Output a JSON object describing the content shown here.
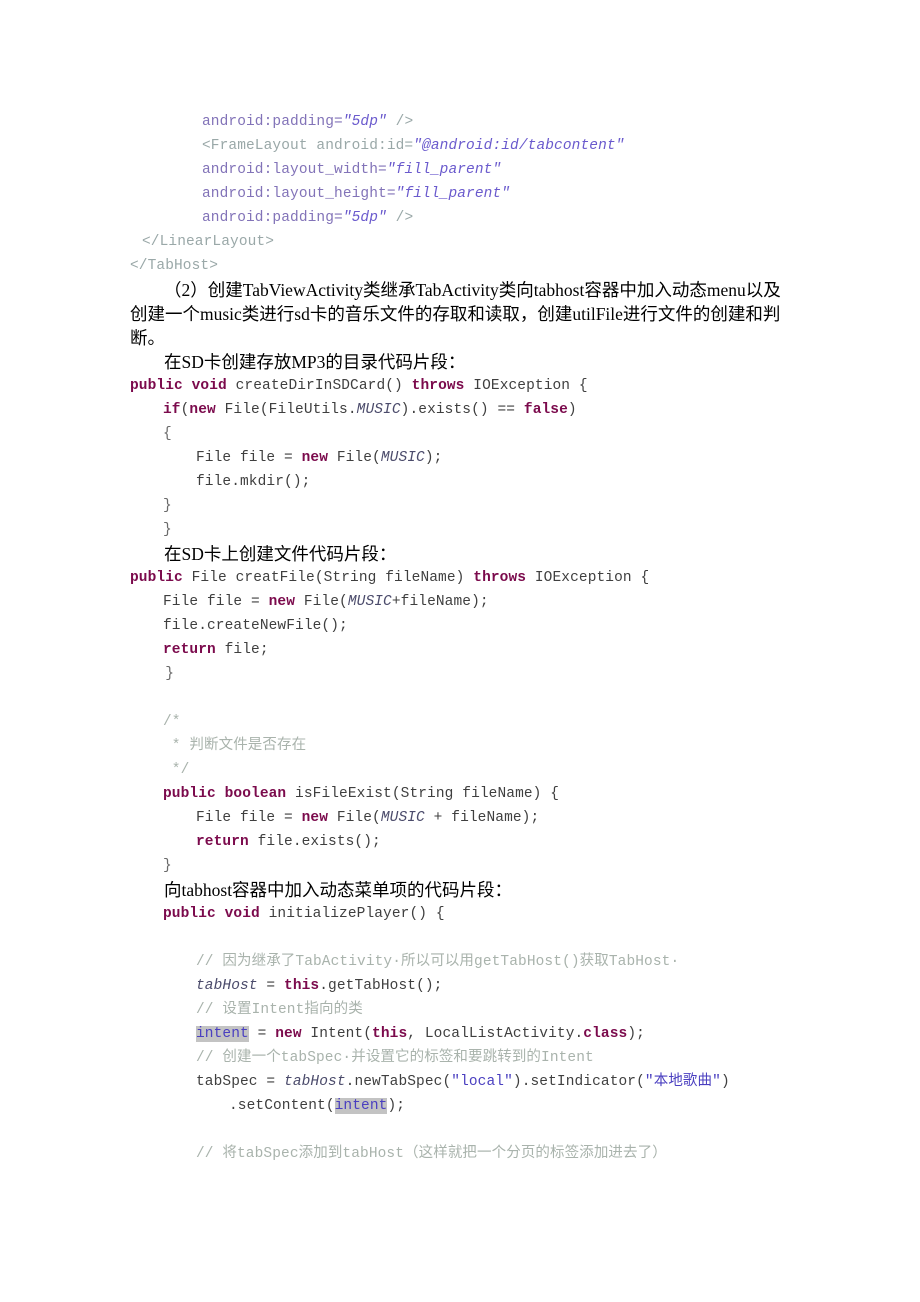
{
  "document": {
    "type": "technical-document-page",
    "language": "zh-CN",
    "page_background": "#ffffff"
  },
  "xml_block": {
    "lines": [
      {
        "indent": 2,
        "tokens": [
          {
            "t": "android:padding=",
            "c": "attr"
          },
          {
            "t": "\"5dp\"",
            "c": "str"
          },
          {
            "t": " />",
            "c": "punct"
          }
        ]
      },
      {
        "indent": 2,
        "tokens": [
          {
            "t": "<FrameLayout android:id=",
            "c": "name"
          },
          {
            "t": "\"@android:id/tabcontent\"",
            "c": "str"
          }
        ]
      },
      {
        "indent": 2,
        "tokens": [
          {
            "t": "android:layout_width=",
            "c": "attr"
          },
          {
            "t": "\"fill_parent\"",
            "c": "str"
          }
        ]
      },
      {
        "indent": 2,
        "tokens": [
          {
            "t": "android:layout_height=",
            "c": "attr"
          },
          {
            "t": "\"fill_parent\"",
            "c": "str"
          }
        ]
      },
      {
        "indent": 2,
        "tokens": [
          {
            "t": "android:padding=",
            "c": "attr"
          },
          {
            "t": "\"5dp\"",
            "c": "str"
          },
          {
            "t": " />",
            "c": "punct"
          }
        ]
      },
      {
        "indent": 1,
        "tokens": [
          {
            "t": "</LinearLayout>",
            "c": "tag"
          }
        ]
      },
      {
        "indent": 0,
        "tokens": [
          {
            "t": "</TabHost>",
            "c": "tag"
          }
        ]
      }
    ]
  },
  "paragraph_1": "（2）创建TabViewActivity类继承TabActivity类向tabhost容器中加入动态menu以及创建一个music类进行sd卡的音乐文件的存取和读取，创建utilFile进行文件的创建和判断。",
  "subhead_1": "在SD卡创建存放MP3的目录代码片段：",
  "code_block_1": {
    "lines": [
      {
        "indent": 0,
        "tokens": [
          {
            "t": "public void",
            "c": "kw"
          },
          {
            "t": " createDirInSDCard() ",
            "c": "plain"
          },
          {
            "t": "throws",
            "c": "kw"
          },
          {
            "t": " IOException {",
            "c": "plain"
          }
        ]
      },
      {
        "indent": 1,
        "tokens": [
          {
            "t": "if",
            "c": "kw"
          },
          {
            "t": "(",
            "c": "plain"
          },
          {
            "t": "new",
            "c": "kw"
          },
          {
            "t": " File(FileUtils.",
            "c": "plain"
          },
          {
            "t": "MUSIC",
            "c": "field"
          },
          {
            "t": ").exists() == ",
            "c": "plain"
          },
          {
            "t": "false",
            "c": "kw"
          },
          {
            "t": ")",
            "c": "plain"
          }
        ]
      },
      {
        "indent": 1,
        "tokens": [
          {
            "t": "{",
            "c": "brace"
          }
        ]
      },
      {
        "indent": 2,
        "tokens": [
          {
            "t": "File file = ",
            "c": "plain"
          },
          {
            "t": "new",
            "c": "kw"
          },
          {
            "t": " File(",
            "c": "plain"
          },
          {
            "t": "MUSIC",
            "c": "field"
          },
          {
            "t": ");",
            "c": "plain"
          }
        ]
      },
      {
        "indent": 2,
        "tokens": [
          {
            "t": "file.mkdir();",
            "c": "plain"
          }
        ]
      },
      {
        "indent": 1,
        "tokens": [
          {
            "t": "}",
            "c": "brace"
          }
        ]
      },
      {
        "indent": 1,
        "tokens": [
          {
            "t": "}",
            "c": "brace"
          }
        ]
      }
    ]
  },
  "subhead_2": "在SD卡上创建文件代码片段：",
  "code_block_2": {
    "lines": [
      {
        "indent": 0,
        "tokens": [
          {
            "t": "public",
            "c": "kw"
          },
          {
            "t": " File creatFile(String fileName) ",
            "c": "plain"
          },
          {
            "t": "throws",
            "c": "kw"
          },
          {
            "t": " IOException {",
            "c": "plain"
          }
        ]
      },
      {
        "indent": 1,
        "tokens": [
          {
            "t": "File file = ",
            "c": "plain"
          },
          {
            "t": "new",
            "c": "kw"
          },
          {
            "t": " File(",
            "c": "plain"
          },
          {
            "t": "MUSIC",
            "c": "field"
          },
          {
            "t": "+fileName);",
            "c": "plain"
          }
        ]
      },
      {
        "indent": 1,
        "tokens": [
          {
            "t": "file.createNewFile();",
            "c": "plain"
          }
        ]
      },
      {
        "indent": 1,
        "tokens": [
          {
            "t": "return",
            "c": "kw"
          },
          {
            "t": " file;",
            "c": "plain"
          }
        ]
      },
      {
        "indent": 0,
        "tokens": [
          {
            "t": "    }",
            "c": "brace"
          }
        ]
      },
      {
        "indent": 0,
        "tokens": [
          {
            "t": "",
            "c": "plain"
          }
        ]
      },
      {
        "indent": 1,
        "tokens": [
          {
            "t": "/*",
            "c": "cmt"
          }
        ]
      },
      {
        "indent": 1,
        "tokens": [
          {
            "t": " * 判断文件是否存在",
            "c": "cmt"
          }
        ]
      },
      {
        "indent": 1,
        "tokens": [
          {
            "t": " */",
            "c": "cmt"
          }
        ]
      },
      {
        "indent": 1,
        "tokens": [
          {
            "t": "public boolean",
            "c": "kw"
          },
          {
            "t": " isFileExist(String fileName) {",
            "c": "plain"
          }
        ]
      },
      {
        "indent": 2,
        "tokens": [
          {
            "t": "File file = ",
            "c": "plain"
          },
          {
            "t": "new",
            "c": "kw"
          },
          {
            "t": " File(",
            "c": "plain"
          },
          {
            "t": "MUSIC",
            "c": "field"
          },
          {
            "t": " + fileName);",
            "c": "plain"
          }
        ]
      },
      {
        "indent": 2,
        "tokens": [
          {
            "t": "return",
            "c": "kw"
          },
          {
            "t": " file.exists();",
            "c": "plain"
          }
        ]
      },
      {
        "indent": 1,
        "tokens": [
          {
            "t": "}",
            "c": "brace"
          }
        ]
      }
    ]
  },
  "subhead_3": "向tabhost容器中加入动态菜单项的代码片段：",
  "code_block_3": {
    "lines": [
      {
        "indent": 1,
        "tokens": [
          {
            "t": "public void",
            "c": "kw"
          },
          {
            "t": " initializePlayer() {",
            "c": "plain"
          }
        ]
      },
      {
        "indent": 0,
        "tokens": [
          {
            "t": "",
            "c": "plain"
          }
        ]
      },
      {
        "indent": 2,
        "tokens": [
          {
            "t": "// 因为继承了TabActivity·所以可以用getTabHost()获取TabHost·",
            "c": "cmt"
          }
        ]
      },
      {
        "indent": 2,
        "tokens": [
          {
            "t": "tabHost",
            "c": "field"
          },
          {
            "t": " = ",
            "c": "plain"
          },
          {
            "t": "this",
            "c": "kw"
          },
          {
            "t": ".getTabHost();",
            "c": "plain"
          }
        ]
      },
      {
        "indent": 2,
        "tokens": [
          {
            "t": "// 设置Intent指向的类",
            "c": "cmt"
          }
        ]
      },
      {
        "indent": 2,
        "tokens": [
          {
            "t": "intent",
            "c": "hl"
          },
          {
            "t": " = ",
            "c": "plain"
          },
          {
            "t": "new",
            "c": "kw"
          },
          {
            "t": " Intent(",
            "c": "plain"
          },
          {
            "t": "this",
            "c": "kw"
          },
          {
            "t": ", LocalListActivity.",
            "c": "plain"
          },
          {
            "t": "class",
            "c": "kw"
          },
          {
            "t": ");",
            "c": "plain"
          }
        ]
      },
      {
        "indent": 2,
        "tokens": [
          {
            "t": "// 创建一个tabSpec·并设置它的标签和要跳转到的Intent",
            "c": "cmt"
          }
        ]
      },
      {
        "indent": 2,
        "tokens": [
          {
            "t": "tabSpec = ",
            "c": "plain"
          },
          {
            "t": "tabHost",
            "c": "field"
          },
          {
            "t": ".newTabSpec(",
            "c": "plain"
          },
          {
            "t": "\"local\"",
            "c": "str"
          },
          {
            "t": ").setIndicator(",
            "c": "plain"
          },
          {
            "t": "\"本地歌曲\"",
            "c": "str"
          },
          {
            "t": ")",
            "c": "plain"
          }
        ]
      },
      {
        "indent": 3,
        "tokens": [
          {
            "t": ".setContent(",
            "c": "plain"
          },
          {
            "t": "intent",
            "c": "hl"
          },
          {
            "t": ");",
            "c": "plain"
          }
        ]
      },
      {
        "indent": 0,
        "tokens": [
          {
            "t": "",
            "c": "plain"
          }
        ]
      },
      {
        "indent": 2,
        "tokens": [
          {
            "t": "// 将tabSpec添加到tabHost（这样就把一个分页的标签添加进去了）",
            "c": "cmt"
          }
        ]
      }
    ]
  },
  "colors": {
    "keyword": "#7b0a4c",
    "string": "#4a3fc0",
    "comment": "#a9b3ac",
    "field": "#4b4b6b",
    "xml_attribute": "#8273b8",
    "xml_tag": "#9aa8a8",
    "highlight_background": "#c3c3c3",
    "page_background": "#ffffff",
    "body_text": "#000000"
  }
}
